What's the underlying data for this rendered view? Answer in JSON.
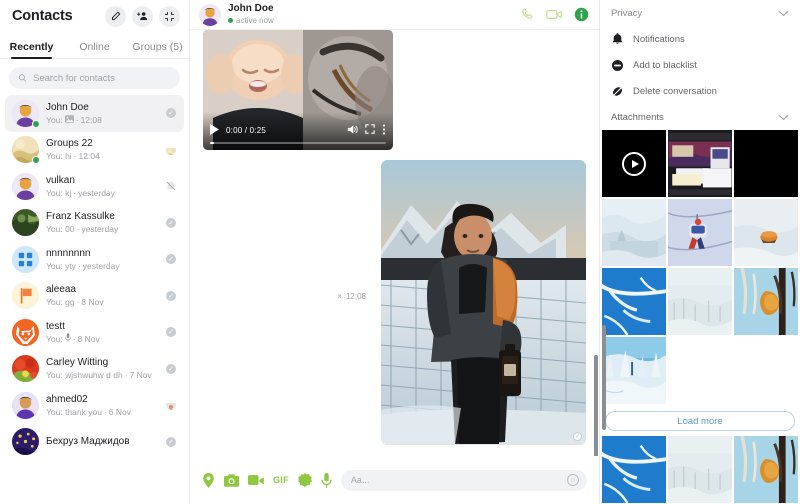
{
  "sidebar": {
    "title": "Contacts",
    "header_icons": [
      {
        "name": "compose-icon",
        "glyph": "✎"
      },
      {
        "name": "add-people-icon",
        "glyph": "👥"
      },
      {
        "name": "collapse-icon",
        "glyph": "⤢"
      }
    ],
    "tabs": [
      {
        "label": "Recently",
        "active": true
      },
      {
        "label": "Online",
        "active": false
      },
      {
        "label": "Groups (5)",
        "active": false
      }
    ],
    "search": {
      "placeholder": "Search for contacts",
      "value": ""
    },
    "contacts": [
      {
        "name": "John Doe",
        "preview": "You:",
        "has_img_icon": true,
        "time": "12:08",
        "selected": true,
        "online": true,
        "status": "check",
        "avatar": "person-purple"
      },
      {
        "name": "Groups 22",
        "preview": "You: hi",
        "has_img_icon": false,
        "time": "12:04",
        "selected": false,
        "online": true,
        "status": "avatar-beige",
        "avatar": "photo-sand"
      },
      {
        "name": "vulkan",
        "preview": "You: kj",
        "has_img_icon": false,
        "time": "yesterday",
        "selected": false,
        "online": false,
        "status": "muted",
        "avatar": "person-purple"
      },
      {
        "name": "Franz Kassulke",
        "preview": "You: 00",
        "has_img_icon": false,
        "time": "yesterday",
        "selected": false,
        "online": false,
        "status": "check",
        "avatar": "photo-green"
      },
      {
        "name": "nnnnnnnn",
        "preview": "You: yty",
        "has_img_icon": false,
        "time": "yesterday",
        "selected": false,
        "online": false,
        "status": "check",
        "avatar": "grid-blue"
      },
      {
        "name": "aleeaa",
        "preview": "You: gg",
        "has_img_icon": false,
        "time": "8 Nov",
        "selected": false,
        "online": false,
        "status": "check",
        "avatar": "flag-orange"
      },
      {
        "name": "testt",
        "preview": "You:",
        "has_mic_icon": true,
        "time": "8 Nov",
        "selected": false,
        "online": false,
        "status": "check",
        "avatar": "fox-orange"
      },
      {
        "name": "Carley Witting",
        "preview": "You: wjshwuhw d dh",
        "has_img_icon": false,
        "time": "7 Nov",
        "selected": false,
        "online": false,
        "status": "check",
        "avatar": "photo-food"
      },
      {
        "name": "ahmed02",
        "preview": "You: thank you",
        "has_img_icon": false,
        "time": "6 Nov",
        "selected": false,
        "online": false,
        "status": "avatar-person",
        "avatar": "person-purple2"
      },
      {
        "name": "Бехруз Маджидов",
        "preview": "",
        "has_img_icon": false,
        "time": "",
        "selected": false,
        "online": false,
        "status": "check",
        "avatar": "photo-night"
      }
    ]
  },
  "chat": {
    "contact_name": "John Doe",
    "status": "active now",
    "actions": [
      {
        "name": "voice-call-icon"
      },
      {
        "name": "video-call-icon"
      },
      {
        "name": "conversation-info-icon"
      }
    ],
    "video_message": {
      "current_time": "0:00",
      "duration": "0:25",
      "time_display": "0:00 / 0:25",
      "progress_percent": 2
    },
    "photo_message": {
      "timestamp": "12:08",
      "delete_label": "×"
    },
    "composer": {
      "placeholder": "Aa...",
      "value": "",
      "tools": [
        {
          "name": "location-icon",
          "label": ""
        },
        {
          "name": "camera-icon",
          "label": ""
        },
        {
          "name": "video-icon",
          "label": ""
        },
        {
          "name": "gif-icon",
          "label": "GIF"
        },
        {
          "name": "sticker-icon",
          "label": ""
        },
        {
          "name": "microphone-icon",
          "label": ""
        }
      ],
      "emoji_icon": "emoji-icon"
    }
  },
  "right_panel": {
    "privacy": {
      "title": "Privacy",
      "items": [
        {
          "label": "Notifications",
          "icon": "bell-icon"
        },
        {
          "label": "Add to blacklist",
          "icon": "block-icon"
        },
        {
          "label": "Delete conversation",
          "icon": "delete-icon"
        }
      ]
    },
    "attachments": {
      "title": "Attachments",
      "load_more_label": "Load more",
      "thumbnails": [
        {
          "name": "video-thumb",
          "kind": "video"
        },
        {
          "name": "screenshot-thumb",
          "kind": "screenshot"
        },
        {
          "name": "black-thumb",
          "kind": "black"
        },
        {
          "name": "snow-mountain-thumb",
          "kind": "snow-pale"
        },
        {
          "name": "ski-lift-thumb",
          "kind": "ski"
        },
        {
          "name": "snow-object-thumb",
          "kind": "snow-obj"
        },
        {
          "name": "frost-branch-thumb",
          "kind": "frost-blue"
        },
        {
          "name": "winter-field-thumb",
          "kind": "winter-pale"
        },
        {
          "name": "dry-leaf-thumb",
          "kind": "leaf"
        },
        {
          "name": "snow-trees-thumb",
          "kind": "snow-trees"
        },
        {
          "name": "frost-blue-thumb-2",
          "kind": "frost-blue"
        },
        {
          "name": "winter-pale-thumb-2",
          "kind": "winter-pale"
        },
        {
          "name": "leaf-thumb-2",
          "kind": "leaf"
        }
      ]
    }
  },
  "colors": {
    "accent_green": "#8fc740",
    "status_green": "#31a24c",
    "link_blue": "#5b9bc6",
    "text_primary": "#1c1e21",
    "text_muted": "#a0a3a8",
    "panel_bg": "#ffffff",
    "selected_row": "#f1f1f3"
  }
}
